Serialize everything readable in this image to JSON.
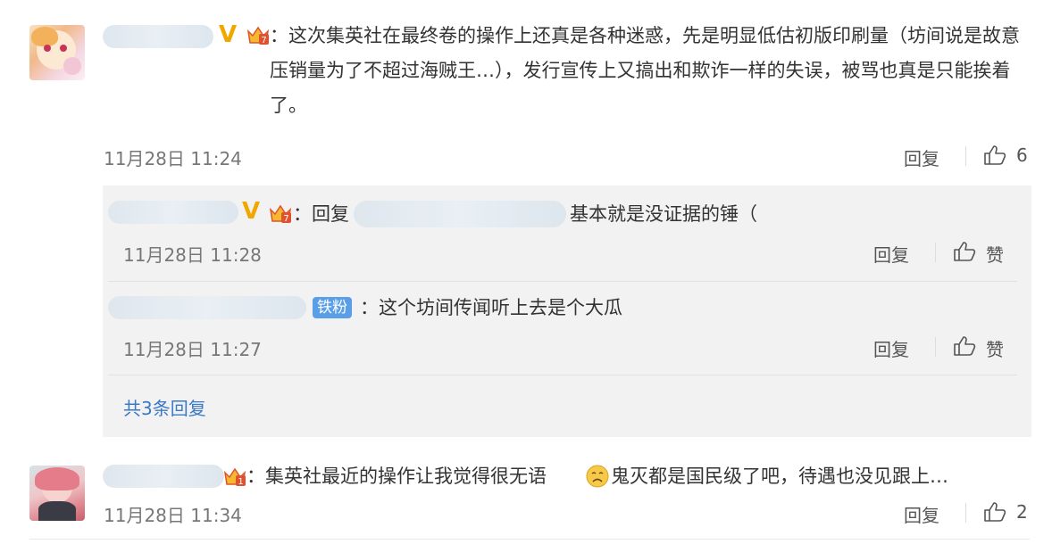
{
  "comments": [
    {
      "text": "：这次集英社在最终卷的操作上还真是各种迷惑，先是明显低估初版印刷量（坊间说是故意压销量为了不超过海贼王…），发行宣传上又搞出和欺诈一样的失误，被骂也真是只能挨着了。",
      "timestamp": "11月28日 11:24",
      "reply_label": "回复",
      "like_count": "6",
      "badges": {
        "verified": "V",
        "level": "7"
      }
    },
    {
      "text": "：集英社最近的操作让我觉得很无语",
      "text_tail": "鬼灭都是国民级了吧，待遇也没见跟上…",
      "timestamp": "11月28日 11:34",
      "reply_label": "回复",
      "like_count": "2",
      "badges": {
        "level": "1"
      }
    }
  ],
  "replies": [
    {
      "reply_prefix": "：回复",
      "text": "基本就是没证据的锤（",
      "timestamp": "11月28日 11:28",
      "reply_label": "回复",
      "like_label": "赞",
      "badges": {
        "verified": "V",
        "level": "7"
      }
    },
    {
      "badge_text": "铁粉",
      "text": "：这个坊间传闻听上去是个大瓜",
      "timestamp": "11月28日 11:27",
      "reply_label": "回复",
      "like_label": "赞"
    }
  ],
  "more_replies": "共3条回复",
  "colors": {
    "link": "#3a79c6",
    "verified": "#f0a800",
    "fan_badge": "#5b9ee8",
    "reply_bg": "#f2f2f2"
  },
  "icons": [
    "thumbs-up-icon",
    "crown-level-icon",
    "verified-v-icon",
    "sad-emoji-icon"
  ]
}
